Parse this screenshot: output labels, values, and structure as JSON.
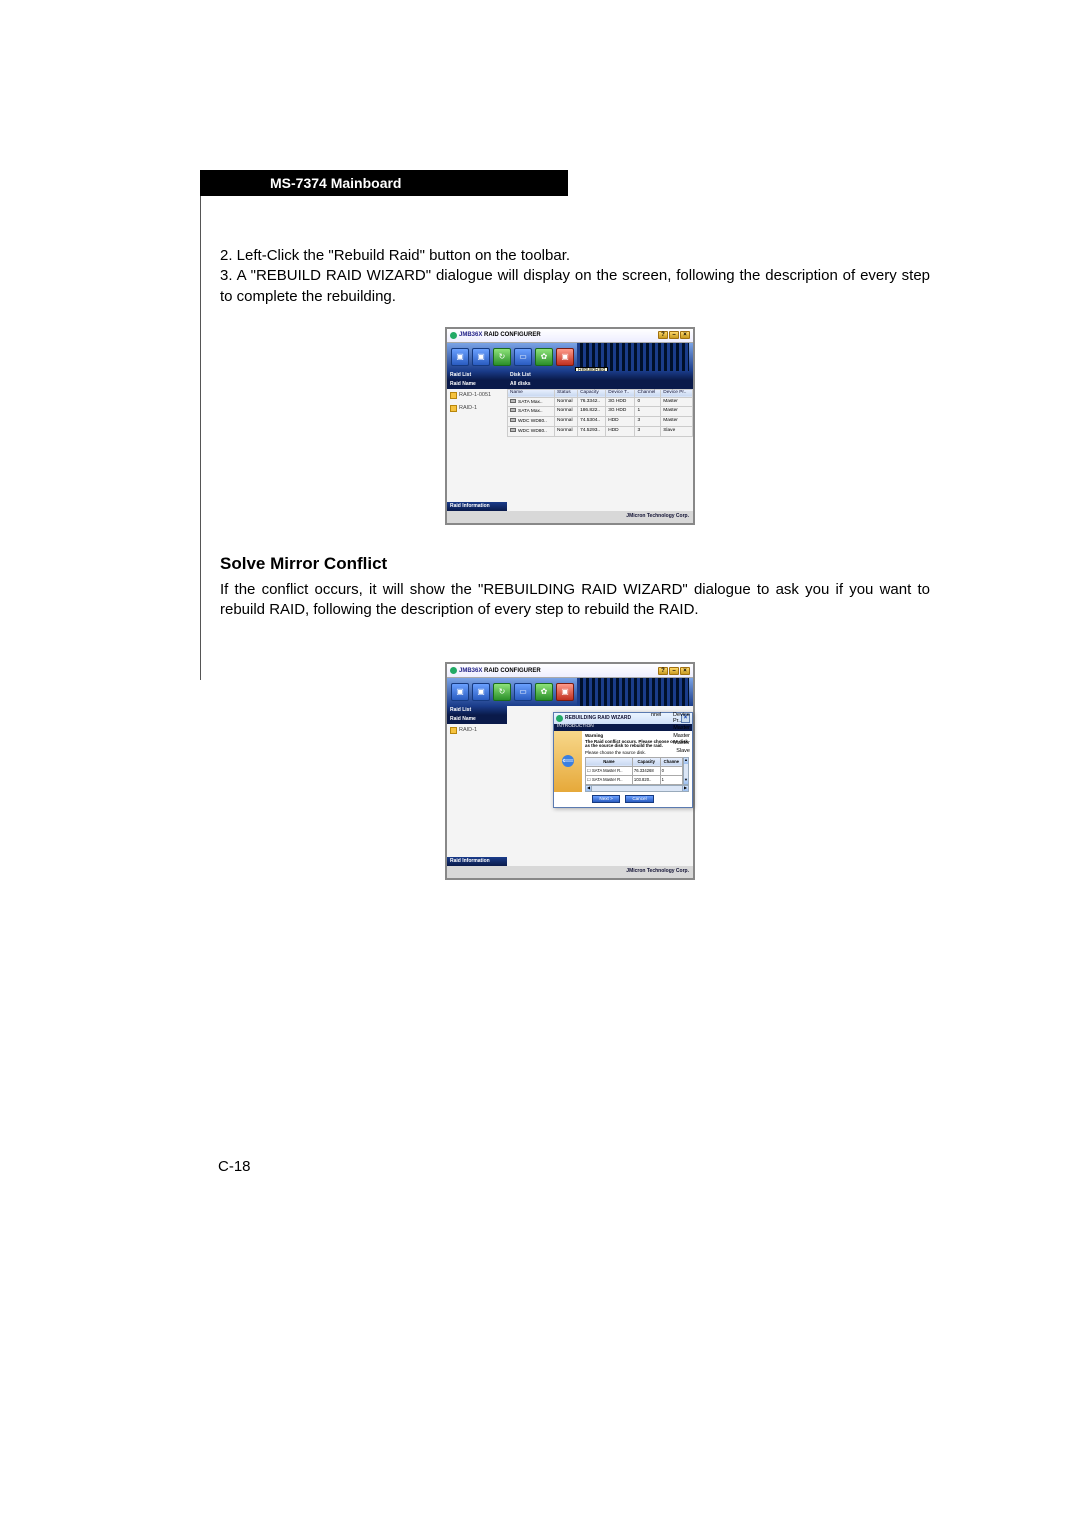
{
  "header": {
    "title": "MS-7374 Mainboard"
  },
  "steps": {
    "s2": "2. Left-Click the \"Rebuild Raid\" button on the toolbar.",
    "s3": "3. A \"REBUILD RAID WIZARD\" dialogue will display on the screen, following the description of every step to complete the rebuilding."
  },
  "section2": {
    "heading": "Solve Mirror Conflict"
  },
  "solve_text": "If the conflict occurs, it will show the \"REBUILDING RAID WIZARD\" dialogue to ask you if you want to rebuild RAID, following the description of every step to rebuild the RAID.",
  "page_num": "C-18",
  "app": {
    "brand_jm": "JMB36X",
    "brand_rest": " RAID CONFIGURER",
    "btn_help": "?",
    "btn_min": "–",
    "btn_close": "×",
    "tooltip": "RebuildRaid",
    "footer": "JMicron Technology Corp."
  },
  "left": {
    "head1": "Raid List",
    "head2": "Raid Information",
    "col": "Raid Name",
    "item1": "RAID-1-0051",
    "item2": "RAID-1"
  },
  "disk": {
    "head": "Disk List",
    "sub": "All disks",
    "cols": {
      "name": "Name",
      "status": "Status",
      "cap": "Capacity",
      "dtype": "Device T..",
      "chan": "Channel",
      "pri": "Device Pr.."
    },
    "rows": [
      {
        "name": "SATA   Max..",
        "status": "Normal",
        "cap": "76.3342..",
        "dtype": "3G HDD",
        "chan": "0",
        "pri": "Master"
      },
      {
        "name": "SATA   Max..",
        "status": "Normal",
        "cap": "186.822..",
        "dtype": "3G HDD",
        "chan": "1",
        "pri": "Master"
      },
      {
        "name": "WDC WD80..",
        "status": "Normal",
        "cap": "74.5304..",
        "dtype": "HDD",
        "chan": "3",
        "pri": "Master"
      },
      {
        "name": "WDC WD80..",
        "status": "Normal",
        "cap": "74.5293..",
        "dtype": "HDD",
        "chan": "3",
        "pri": "Slave"
      }
    ]
  },
  "wizard": {
    "title": "REBUILDING RAID WIZARD",
    "intro": "INTRODUCTION",
    "warn": "Warning",
    "text": "The Raid conflict occurs. Please choose one disk as the source disk to rebuild the raid.",
    "choose": "Please choose the source disk.",
    "cols": {
      "name": "Name",
      "cap": "Capacity",
      "chan": "Channe"
    },
    "rows": [
      {
        "cb": "☐",
        "name": "SATA   Master R..",
        "cap": "76.334268",
        "chan": "0"
      },
      {
        "cb": "☐",
        "name": "SATA   Master R..",
        "cap": "103.820..",
        "chan": "1"
      }
    ],
    "next": "Next >",
    "cancel": "Cancel",
    "close": "×"
  },
  "viscol": {
    "h1": "nnel",
    "h2": "Device Pr..",
    "rows": [
      "Master",
      "Master",
      "Master",
      "Slave"
    ]
  }
}
